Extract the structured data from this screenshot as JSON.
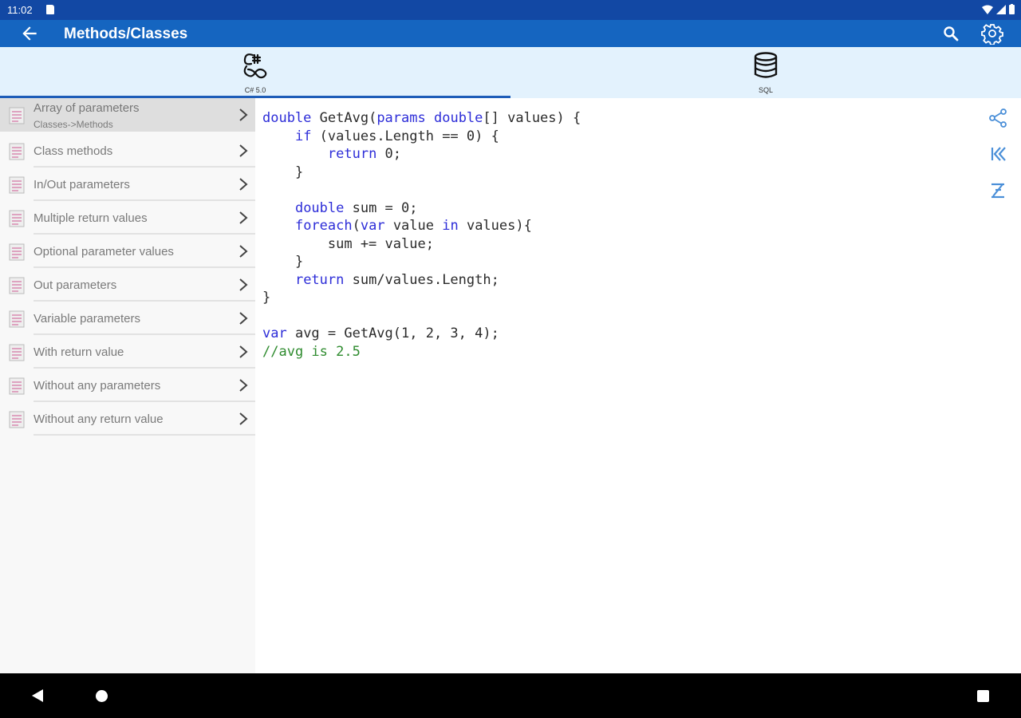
{
  "status_bar": {
    "time": "11:02"
  },
  "app_bar": {
    "title": "Methods/Classes"
  },
  "tabs": [
    {
      "label": "C# 5.0",
      "icon": "csharp-icon",
      "selected": true
    },
    {
      "label": "SQL",
      "icon": "database-icon",
      "selected": false
    }
  ],
  "sidebar": {
    "items": [
      {
        "label": "Array of parameters",
        "sublabel": "Classes->Methods",
        "selected": true
      },
      {
        "label": "Class methods"
      },
      {
        "label": "In/Out parameters"
      },
      {
        "label": "Multiple return values"
      },
      {
        "label": "Optional parameter values"
      },
      {
        "label": "Out parameters"
      },
      {
        "label": "Variable parameters"
      },
      {
        "label": "With return value"
      },
      {
        "label": "Without any parameters"
      },
      {
        "label": "Without any return value"
      }
    ]
  },
  "code": {
    "lines": [
      [
        {
          "t": "double",
          "c": "kw"
        },
        {
          "t": " GetAvg("
        },
        {
          "t": "params",
          "c": "kw"
        },
        {
          "t": " "
        },
        {
          "t": "double",
          "c": "kw"
        },
        {
          "t": "[] values) {"
        }
      ],
      [
        {
          "t": "    "
        },
        {
          "t": "if",
          "c": "kw"
        },
        {
          "t": " (values.Length == 0) {"
        }
      ],
      [
        {
          "t": "        "
        },
        {
          "t": "return",
          "c": "kw"
        },
        {
          "t": " 0;"
        }
      ],
      [
        {
          "t": "    }"
        }
      ],
      [
        {
          "t": ""
        }
      ],
      [
        {
          "t": "    "
        },
        {
          "t": "double",
          "c": "kw"
        },
        {
          "t": " sum = 0;"
        }
      ],
      [
        {
          "t": "    "
        },
        {
          "t": "foreach",
          "c": "kw"
        },
        {
          "t": "("
        },
        {
          "t": "var",
          "c": "kw"
        },
        {
          "t": " value "
        },
        {
          "t": "in",
          "c": "kw"
        },
        {
          "t": " values){"
        }
      ],
      [
        {
          "t": "        sum += value;"
        }
      ],
      [
        {
          "t": "    }"
        }
      ],
      [
        {
          "t": "    "
        },
        {
          "t": "return",
          "c": "kw"
        },
        {
          "t": " sum/values.Length;"
        }
      ],
      [
        {
          "t": "}"
        }
      ],
      [
        {
          "t": ""
        }
      ],
      [
        {
          "t": "var",
          "c": "kw"
        },
        {
          "t": " avg = GetAvg(1, 2, 3, 4);"
        }
      ],
      [
        {
          "t": "//avg is 2.5",
          "c": "cm"
        }
      ]
    ]
  },
  "code_actions": {
    "icons": [
      "share-icon",
      "first-page-icon",
      "last-page-icon"
    ]
  },
  "colors": {
    "status_bar": "#1248a4",
    "app_bar": "#1565c0",
    "tab_bar": "#e3f2fd",
    "keyword": "#2d2dd8",
    "comment": "#2e8b2e"
  }
}
